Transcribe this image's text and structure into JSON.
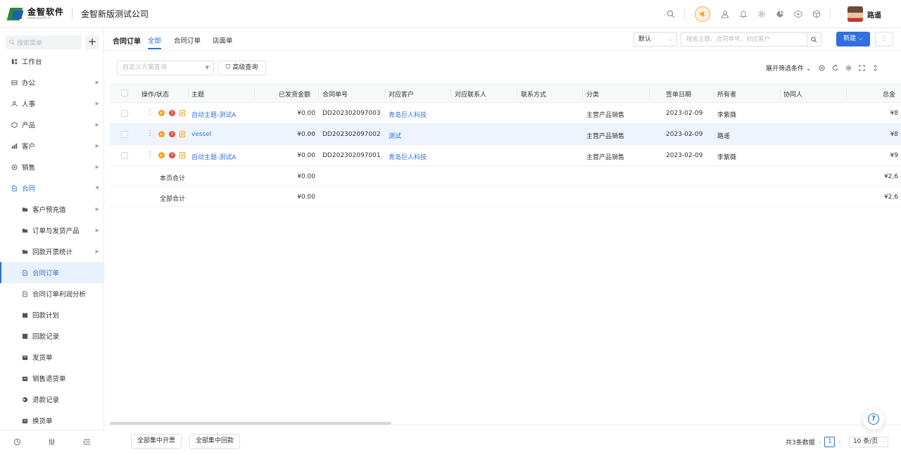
{
  "header": {
    "logo_title": "金智软件",
    "logo_sub": "www.jzsoft.cn",
    "company": "金智新版测试公司",
    "user_name": "路遥"
  },
  "sidebar": {
    "search_placeholder": "搜索菜单",
    "add_label": "+",
    "items": [
      {
        "label": "工作台",
        "icon": "dashboard-icon",
        "arrow": false
      },
      {
        "label": "办公",
        "icon": "office-icon",
        "arrow": true
      },
      {
        "label": "人事",
        "icon": "people-icon",
        "arrow": true
      },
      {
        "label": "产品",
        "icon": "product-icon",
        "arrow": true
      },
      {
        "label": "客户",
        "icon": "customer-icon",
        "arrow": true
      },
      {
        "label": "销售",
        "icon": "sales-icon",
        "arrow": true
      },
      {
        "label": "合同",
        "icon": "contract-icon",
        "arrow": true,
        "open": true
      },
      {
        "label": "客户预充值",
        "icon": "folder-icon",
        "arrow": true,
        "sub": true
      },
      {
        "label": "订单与发货产品",
        "icon": "folder-icon",
        "arrow": true,
        "sub": true
      },
      {
        "label": "回款开票统计",
        "icon": "folder-icon",
        "arrow": true,
        "sub": true
      },
      {
        "label": "合同订单",
        "icon": "document-icon",
        "sub": true,
        "active": true
      },
      {
        "label": "合同订单利润分析",
        "icon": "document-icon",
        "sub": true
      },
      {
        "label": "回款计划",
        "icon": "calendar-icon",
        "sub": true
      },
      {
        "label": "回款记录",
        "icon": "record-icon",
        "sub": true
      },
      {
        "label": "发货单",
        "icon": "shipping-icon",
        "sub": true
      },
      {
        "label": "销售退货单",
        "icon": "return-icon",
        "sub": true
      },
      {
        "label": "退款记录",
        "icon": "refund-icon",
        "sub": true
      },
      {
        "label": "换货单",
        "icon": "exchange-icon",
        "sub": true
      }
    ]
  },
  "toolbar": {
    "page_title": "合同订单",
    "tabs": [
      "全部",
      "合同订单",
      "店面单"
    ],
    "view_select": "默认",
    "search_placeholder": "搜索主题、合同单号、对应客户",
    "new_button": "新建",
    "more_button": "⋮",
    "plan_placeholder": "自定义方案查询",
    "advanced_query": "高级查询",
    "expand_filters": "展开筛选条件"
  },
  "table": {
    "columns": [
      "操作/状态",
      "主题",
      "已发货金额",
      "合同单号",
      "对应客户",
      "对应联系人",
      "联系方式",
      "分类",
      "签单日期",
      "所有者",
      "协同人",
      "总金"
    ],
    "rows": [
      {
        "subject": "自动主题-测试A",
        "shipped": "¥0.00",
        "order_no": "DD202302097003",
        "customer": "青岛巨人科技",
        "contact": "",
        "phone": "",
        "category": "主营产品销售",
        "date": "2023-02-09",
        "owner": "李紫薇",
        "collab": "",
        "total": "¥8"
      },
      {
        "subject": "vessel",
        "shipped": "¥0.00",
        "order_no": "DD202302097002",
        "customer": "测试",
        "contact": "",
        "phone": "",
        "category": "主营产品销售",
        "date": "2023-02-09",
        "owner": "路遥",
        "collab": "",
        "total": "¥8"
      },
      {
        "subject": "自动主题-测试A",
        "shipped": "¥0.00",
        "order_no": "DD202302097001",
        "customer": "青岛巨人科技",
        "contact": "",
        "phone": "",
        "category": "主营产品销售",
        "date": "2023-02-09",
        "owner": "李紫薇",
        "collab": "",
        "total": "¥9"
      }
    ],
    "summary": [
      {
        "label": "本页合计",
        "shipped": "¥0.00",
        "total": "¥2,6"
      },
      {
        "label": "全部合计",
        "shipped": "¥0.00",
        "total": "¥2,6"
      }
    ]
  },
  "footer": {
    "batch_invoice": "全部集中开票",
    "batch_payment": "全部集中回款",
    "total_text": "共3条数据",
    "page": "1",
    "page_size": "10 条/页"
  },
  "colors": {
    "primary": "#2f6fdf",
    "warning": "#ff9f1c",
    "danger": "#f04a3e"
  }
}
